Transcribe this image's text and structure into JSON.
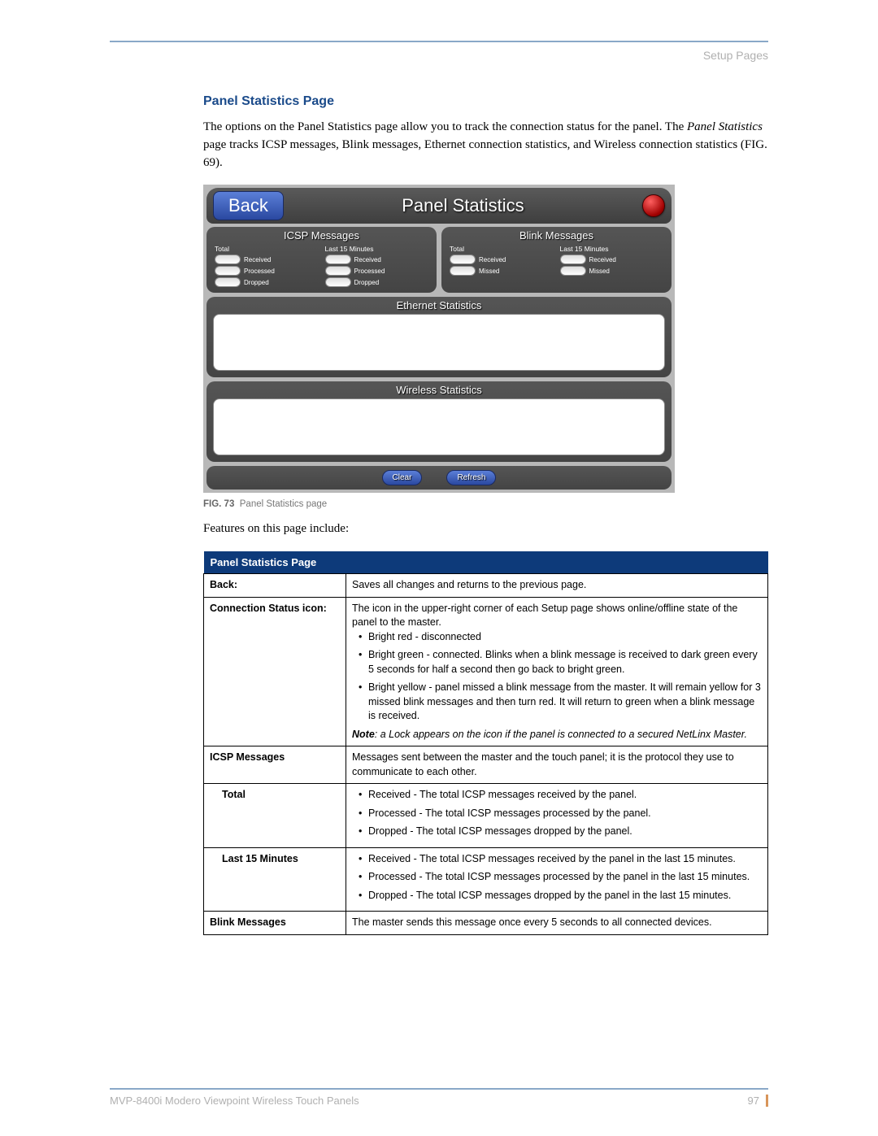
{
  "header": {
    "section": "Setup Pages"
  },
  "heading": "Panel Statistics Page",
  "intro": {
    "p1a": "The options on the Panel Statistics page allow you to track the connection status for the panel. The ",
    "p1b": "Panel Statistics",
    "p1c": " page tracks ICSP messages, Blink messages, Ethernet connection statistics, and Wireless connection statistics (FIG. 69)."
  },
  "screenshot": {
    "back": "Back",
    "title": "Panel Statistics",
    "icsp": {
      "title": "ICSP Messages",
      "colTotal": "Total",
      "colLast": "Last 15 Minutes",
      "rows": [
        "Received",
        "Processed",
        "Dropped"
      ]
    },
    "blink": {
      "title": "Blink Messages",
      "colTotal": "Total",
      "colLast": "Last 15 Minutes",
      "rows": [
        "Received",
        "Missed"
      ]
    },
    "ethernet": "Ethernet Statistics",
    "wireless": "Wireless Statistics",
    "clear": "Clear",
    "refresh": "Refresh"
  },
  "caption": {
    "fig": "FIG. 73",
    "text": "Panel Statistics page"
  },
  "featuresLead": "Features on this page include:",
  "table": {
    "header": "Panel Statistics Page",
    "rows": {
      "back": {
        "label": "Back:",
        "desc": "Saves all changes and returns to the previous page."
      },
      "conn": {
        "label": "Connection Status icon:",
        "desc": "The icon in the upper-right corner of each Setup page shows online/offline state of the panel to the master.",
        "b1": "Bright red - disconnected",
        "b2": "Bright green - connected. Blinks when a blink message is received to dark green every 5 seconds for half a second then go back to bright green.",
        "b3": "Bright yellow - panel missed a blink message from the master. It will remain yellow for 3 missed blink messages and then turn red. It will return to green when a blink message is received.",
        "noteBold": "Note",
        "note": ": a Lock appears on the icon if the panel is connected to a secured NetLinx Master."
      },
      "icsp": {
        "label": "ICSP Messages",
        "desc": "Messages sent between the master and the touch panel; it is the protocol they use to communicate to each other."
      },
      "total": {
        "label": "Total",
        "b1": "Received - The total ICSP messages received by the panel.",
        "b2": "Processed - The total ICSP messages processed by the panel.",
        "b3": "Dropped - The total ICSP messages dropped by the panel."
      },
      "last15": {
        "label": "Last 15 Minutes",
        "b1": "Received - The total ICSP messages received by the panel in the last 15 minutes.",
        "b2": "Processed - The total ICSP messages processed by the panel in the last 15 minutes.",
        "b3": "Dropped - The total ICSP messages dropped by the panel in the last 15 minutes."
      },
      "blinkm": {
        "label": "Blink Messages",
        "desc": "The master sends this message once every 5 seconds to all connected devices."
      }
    }
  },
  "footer": {
    "title": "MVP-8400i Modero Viewpoint Wireless Touch Panels",
    "page": "97"
  }
}
